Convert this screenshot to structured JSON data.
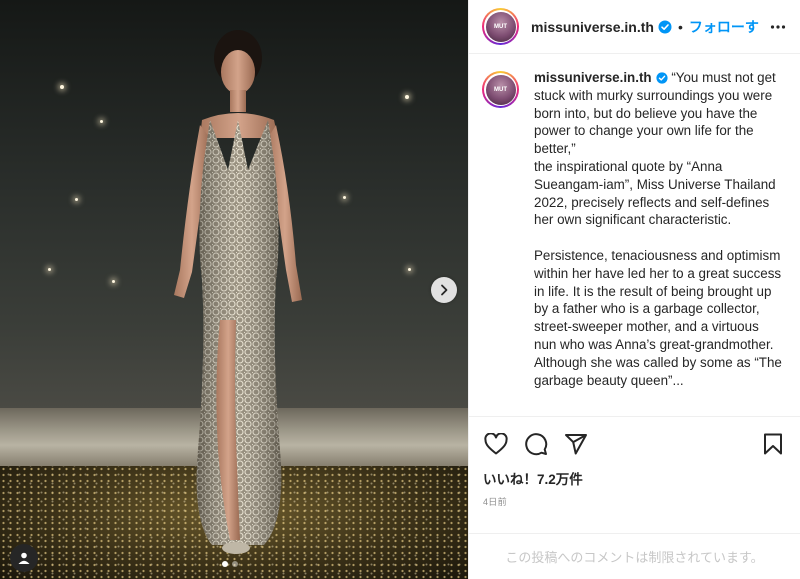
{
  "post": {
    "username": "missuniverse.in.th",
    "separator": "•",
    "follow_label": "フォローする",
    "avatar_logo_text": "MUT",
    "caption_username": "missuniverse.in.th",
    "caption_text": " “You must not get stuck with murky surroundings you were born into, but do believe you have the power to change your own life for the better,”\nthe inspirational quote by “Anna Sueangam-iam”, Miss Universe Thailand 2022, precisely reflects and self-defines her own significant characteristic.\n\nPersistence, tenaciousness and optimism within her have led her to a great success in life. It is the result of being brought up by a father who is a garbage collector, street-sweeper mother, and a virtuous nun who was Anna’s great-grandmother. Although she was called by some as “The garbage beauty queen”...",
    "likes": "いいね！7.2万件",
    "date": "4日前",
    "comments_disabled": "この投稿へのコメントは制限されています。"
  },
  "media": {
    "slide_count": 2,
    "active_slide": 1
  },
  "icons": {
    "verified": "verified-badge-icon",
    "more": "more-options-icon",
    "like": "heart-icon",
    "comment": "comment-icon",
    "share": "share-icon",
    "save": "bookmark-icon",
    "next": "chevron-right-icon",
    "tag": "user-tag-icon"
  },
  "colors": {
    "accent": "#0095f6",
    "text": "#262626",
    "muted": "#8e8e8e",
    "border": "#efefef"
  }
}
